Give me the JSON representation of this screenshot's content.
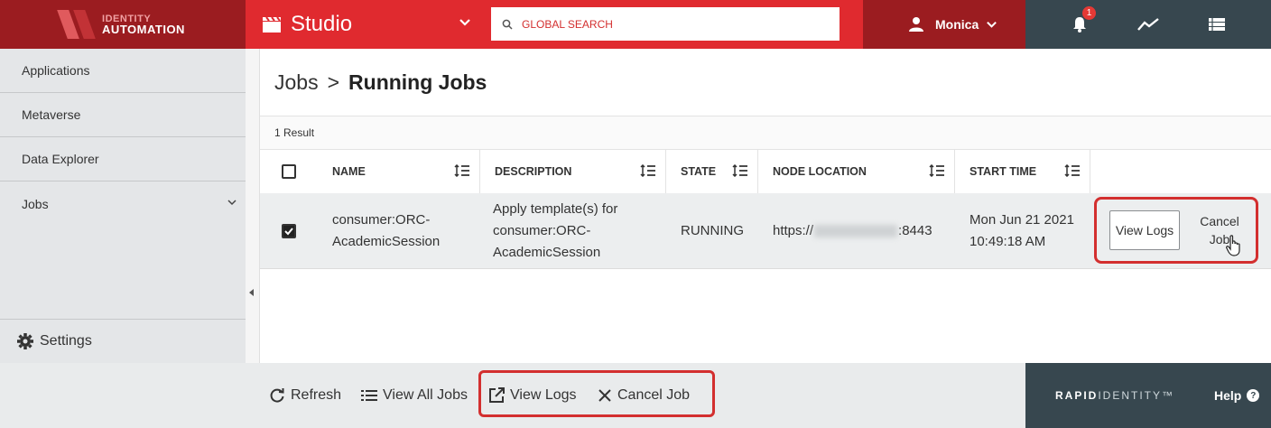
{
  "brand": {
    "line1": "IDENTITY",
    "line2": "AUTOMATION"
  },
  "studio": {
    "title": "Studio"
  },
  "search": {
    "placeholder": "GLOBAL SEARCH"
  },
  "user": {
    "name": "Monica"
  },
  "notifications": {
    "count": "1"
  },
  "sidebar": {
    "items": [
      {
        "label": "Applications"
      },
      {
        "label": "Metaverse"
      },
      {
        "label": "Data Explorer"
      },
      {
        "label": "Jobs"
      }
    ],
    "settings_label": "Settings"
  },
  "breadcrumb": {
    "parent": "Jobs",
    "separator": ">",
    "current": "Running Jobs"
  },
  "results": {
    "count_text": "1 Result"
  },
  "table": {
    "columns": [
      "NAME",
      "DESCRIPTION",
      "STATE",
      "NODE LOCATION",
      "START TIME"
    ],
    "rows": [
      {
        "checked": true,
        "name": "consumer:ORC-AcademicSession",
        "description": "Apply template(s) for consumer:ORC-AcademicSession",
        "state": "RUNNING",
        "node_prefix": "https://",
        "node_suffix": ":8443",
        "start_time": "Mon Jun 21 2021 10:49:18 AM",
        "actions": {
          "view_logs": "View Logs",
          "cancel_job": "Cancel Job"
        }
      }
    ]
  },
  "bottom_actions": {
    "refresh": "Refresh",
    "view_all_jobs": "View All Jobs",
    "view_logs": "View Logs",
    "cancel_job": "Cancel Job"
  },
  "footer": {
    "logo_bold": "RAPID",
    "logo_light": "IDENTITY™",
    "help": "Help"
  },
  "colors": {
    "brand_dark": "#9b1c20",
    "brand_red": "#e02a2f",
    "slate": "#37474f",
    "highlight": "#d32f2f"
  }
}
